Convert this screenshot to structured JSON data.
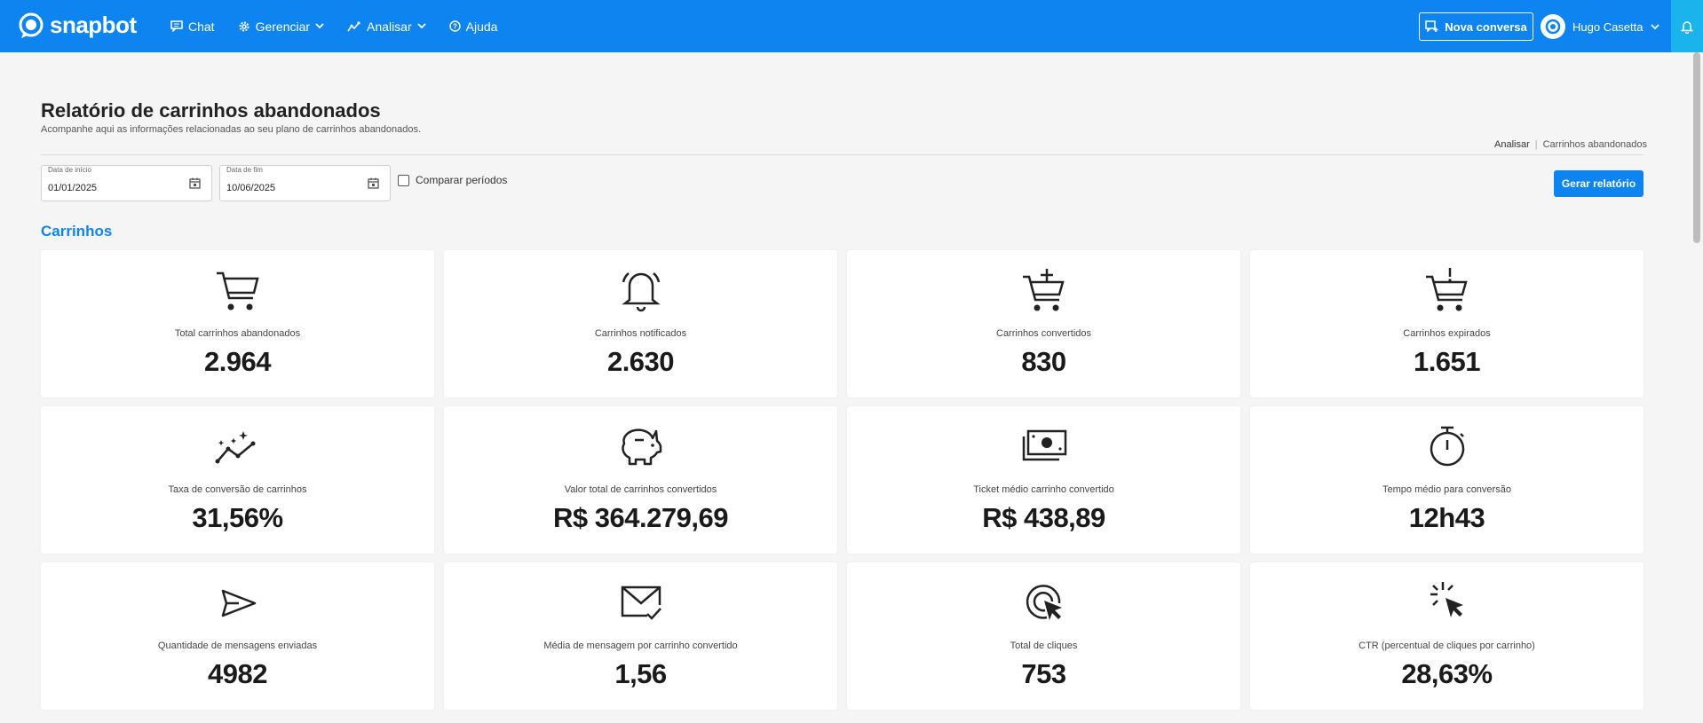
{
  "brand": {
    "name": "snapbot",
    "primary_color": "#0d84f0",
    "accent_color": "#1ab3ec"
  },
  "nav": {
    "items": [
      {
        "label": "Chat",
        "icon": "chat-icon",
        "dropdown": false
      },
      {
        "label": "Gerenciar",
        "icon": "gear-icon",
        "dropdown": true
      },
      {
        "label": "Analisar",
        "icon": "analytics-icon",
        "dropdown": true
      },
      {
        "label": "Ajuda",
        "icon": "help-icon",
        "dropdown": false
      }
    ],
    "new_conversation": "Nova conversa",
    "user_name": "Hugo Casetta"
  },
  "page": {
    "title": "Relatório de carrinhos abandonados",
    "subtitle": "Acompanhe aqui as informações relacionadas ao seu plano de carrinhos abandonados.",
    "breadcrumb": [
      "Analisar",
      "Carrinhos abandonados"
    ]
  },
  "filters": {
    "start": {
      "label": "Data de início",
      "value": "01/01/2025"
    },
    "end": {
      "label": "Data de fim",
      "value": "10/06/2025"
    },
    "compare_label": "Comparar períodos",
    "compare_checked": false,
    "generate_label": "Gerar relatório"
  },
  "section_title": "Carrinhos",
  "cards": [
    {
      "icon": "cart-icon",
      "label": "Total carrinhos abandonados",
      "value": "2.964"
    },
    {
      "icon": "bell-icon",
      "label": "Carrinhos notificados",
      "value": "2.630"
    },
    {
      "icon": "cart-plus-icon",
      "label": "Carrinhos convertidos",
      "value": "830"
    },
    {
      "icon": "cart-alert-icon",
      "label": "Carrinhos expirados",
      "value": "1.651"
    },
    {
      "icon": "trend-sparkle-icon",
      "label": "Taxa de conversão de carrinhos",
      "value": "31,56%"
    },
    {
      "icon": "piggy-bank-icon",
      "label": "Valor total de carrinhos convertidos",
      "value": "R$ 364.279,69"
    },
    {
      "icon": "cash-icon",
      "label": "Ticket médio carrinho convertido",
      "value": "R$ 438,89"
    },
    {
      "icon": "stopwatch-icon",
      "label": "Tempo médio para conversão",
      "value": "12h43"
    },
    {
      "icon": "send-icon",
      "label": "Quantidade de mensagens enviadas",
      "value": "4982"
    },
    {
      "icon": "mail-check-icon",
      "label": "Média de mensagem por carrinho convertido",
      "value": "1,56"
    },
    {
      "icon": "click-target-icon",
      "label": "Total de cliques",
      "value": "753"
    },
    {
      "icon": "click-sparkle-icon",
      "label": "CTR (percentual de cliques por carrinho)",
      "value": "28,63%"
    }
  ]
}
